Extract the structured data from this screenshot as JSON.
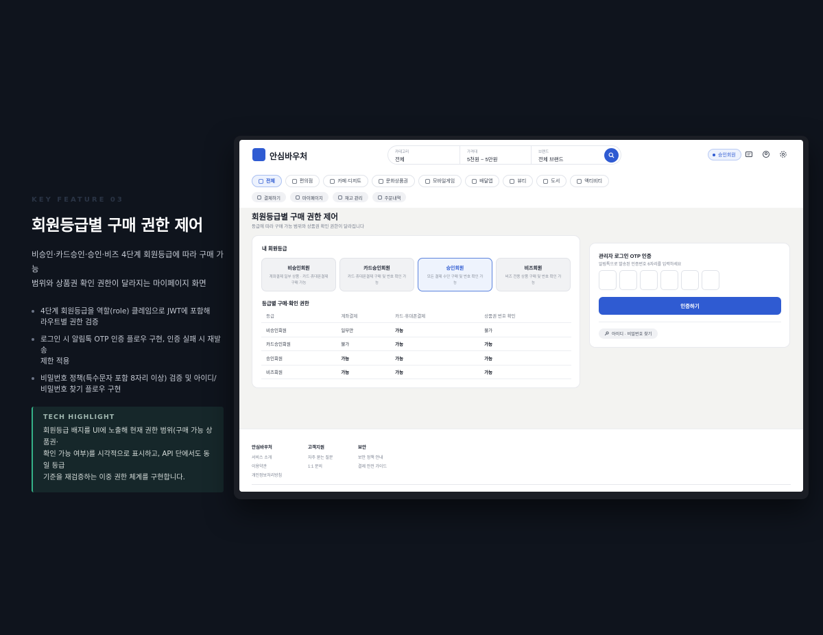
{
  "left": {
    "kicker": "KEY FEATURE 03",
    "headline": "회원등급별 구매 권한 제어",
    "lead_lines": [
      "비승인·카드승인·승인·비즈 4단계 회원등급에 따라 구매 가능",
      "범위와 상품권 확인 권한이 달라지는 마이페이지 화면"
    ],
    "bullets": [
      [
        "4단계 회원등급을 역할(role) 클레임으로 JWT에 포함해",
        "라우트별 권한 검증"
      ],
      [
        "로그인 시 알림톡 OTP 인증 플로우 구현, 인증 실패 시 재발송",
        "제한 적용"
      ],
      [
        "비밀번호 정책(특수문자 포함 8자리 이상) 검증 및 아이디/",
        "비밀번호 찾기 플로우 구현"
      ]
    ],
    "tech": {
      "title": "TECH HIGHLIGHT",
      "lines": [
        "회원등급 배지를 UI에 노출해 현재 권한 범위(구매 가능 상품권·",
        "확인 가능 여부)를 시각적으로 표시하고, API 단에서도 동일 등급",
        "기준을 재검증하는 이중 권한 체계를 구현합니다."
      ]
    }
  },
  "header": {
    "brand": "안심바우처",
    "search": [
      {
        "label": "카테고리",
        "value": "전체"
      },
      {
        "label": "가격대",
        "value": "5천원 ~ 5만원"
      },
      {
        "label": "브랜드",
        "value": "전체 브랜드"
      }
    ],
    "grade_badge": "승인회원",
    "icons": [
      "search-icon",
      "message-icon",
      "user-icon",
      "settings-icon"
    ]
  },
  "categories": [
    "전체",
    "편의점",
    "카페·디저트",
    "문화상품권",
    "모바일게임",
    "배달앱",
    "뷰티",
    "도서",
    "액티비티"
  ],
  "subnav": [
    "결제하기",
    "마이페이지",
    "재고 관리",
    "주문내역"
  ],
  "page": {
    "title": "회원등급별 구매 권한 제어",
    "subtitle": "등급에 따라 구매 가능 범위와 상품권 확인 권한이 달라집니다"
  },
  "my_grade": {
    "title": "내 회원등급",
    "grades": [
      {
        "name": "비승인회원",
        "desc": [
          "계좌결제 일부 상품 · 카드·휴대폰결제",
          "구매 가능"
        ]
      },
      {
        "name": "카드승인회원",
        "desc": [
          "카드·휴대폰결제 구매 및 번호 확인 가",
          "능"
        ]
      },
      {
        "name": "승인회원",
        "desc": [
          "모든 결제 수단 구매 및 번호 확인 가",
          "능"
        ]
      },
      {
        "name": "비즈회원",
        "desc": [
          "비즈 전용 상품 구매 및 번호 확인 가",
          "능"
        ]
      }
    ]
  },
  "permissions": {
    "title": "등급별 구매·확인 권한",
    "headers": [
      "등급",
      "계좌결제",
      "카드·휴대폰결제",
      "상품권 번호 확인"
    ],
    "rows": [
      [
        "비승인회원",
        "일부만",
        "가능",
        "불가"
      ],
      [
        "카드승인회원",
        "불가",
        "가능",
        "가능"
      ],
      [
        "승인회원",
        "가능",
        "가능",
        "가능"
      ],
      [
        "비즈회원",
        "가능",
        "가능",
        "가능"
      ]
    ]
  },
  "otp": {
    "title": "관리자 로그인 OTP 인증",
    "subtitle": "알림톡으로 발송된 인증번호 6자리를 입력하세요",
    "button": "인증하기",
    "find_link": "아이디 · 비밀번호 찾기"
  },
  "footer": {
    "cols": [
      {
        "title": "안심바우처",
        "items": [
          "서비스 소개",
          "이용약관",
          "개인정보처리방침"
        ]
      },
      {
        "title": "고객지원",
        "items": [
          "자주 묻는 질문",
          "1:1 문의"
        ]
      },
      {
        "title": "보안",
        "items": [
          "보안 정책 안내",
          "결제 안전 가이드"
        ]
      }
    ]
  },
  "colors": {
    "accent": "#2f5bd2",
    "highlight_border": "#35b389",
    "background": "#0f141d"
  }
}
